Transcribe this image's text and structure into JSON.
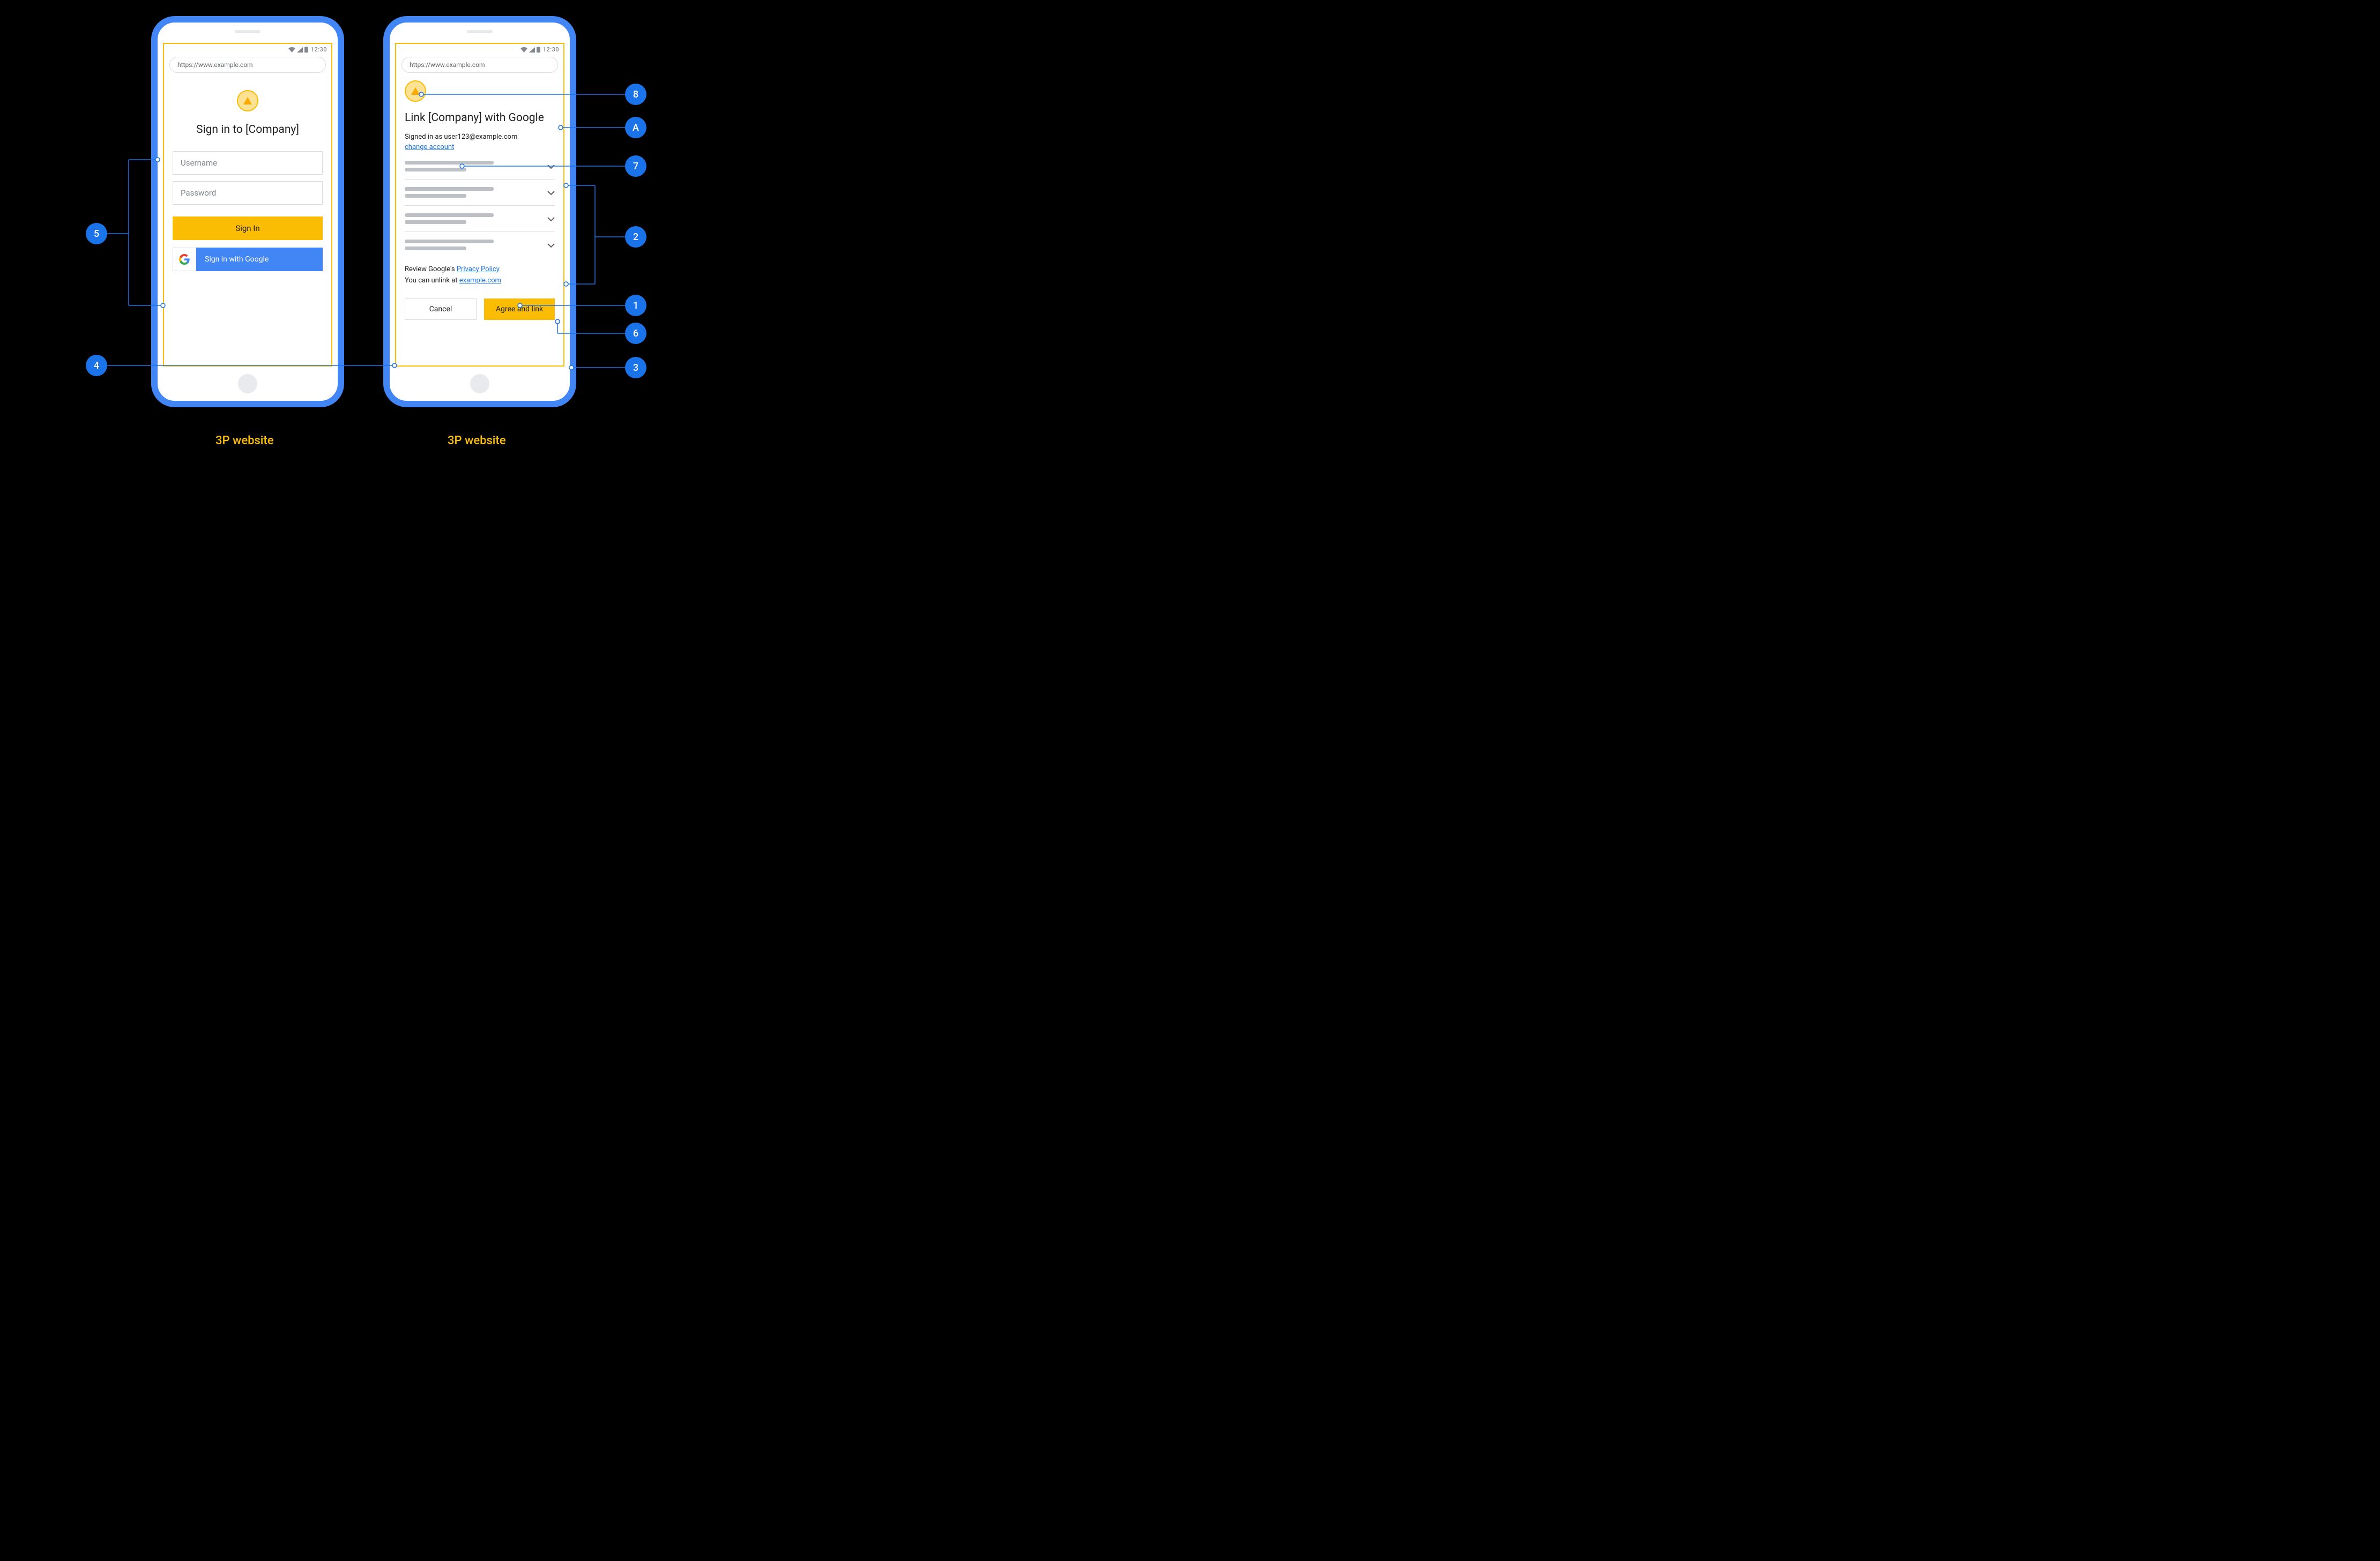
{
  "status_time": "12:30",
  "url": "https://www.example.com",
  "phone1": {
    "title": "Sign in to [Company]",
    "username_placeholder": "Username",
    "password_placeholder": "Password",
    "signin_label": "Sign In",
    "google_label": "Sign in with Google"
  },
  "phone2": {
    "title": "Link [Company] with Google",
    "signed_in_as": "Signed in as user123@example.com",
    "change_account": "change account",
    "review_prefix": "Review Google's ",
    "review_link": "Privacy Policy",
    "unlink_prefix": "You can unlink at ",
    "unlink_link": "example.com",
    "cancel_label": "Cancel",
    "agree_label": "Agree and link"
  },
  "callouts": {
    "c1": "1",
    "c2": "2",
    "c3": "3",
    "c4": "4",
    "c5": "5",
    "c6": "6",
    "c7": "7",
    "c8": "8",
    "cA": "A"
  },
  "captions": {
    "left": "3P website",
    "right": "3P website"
  }
}
